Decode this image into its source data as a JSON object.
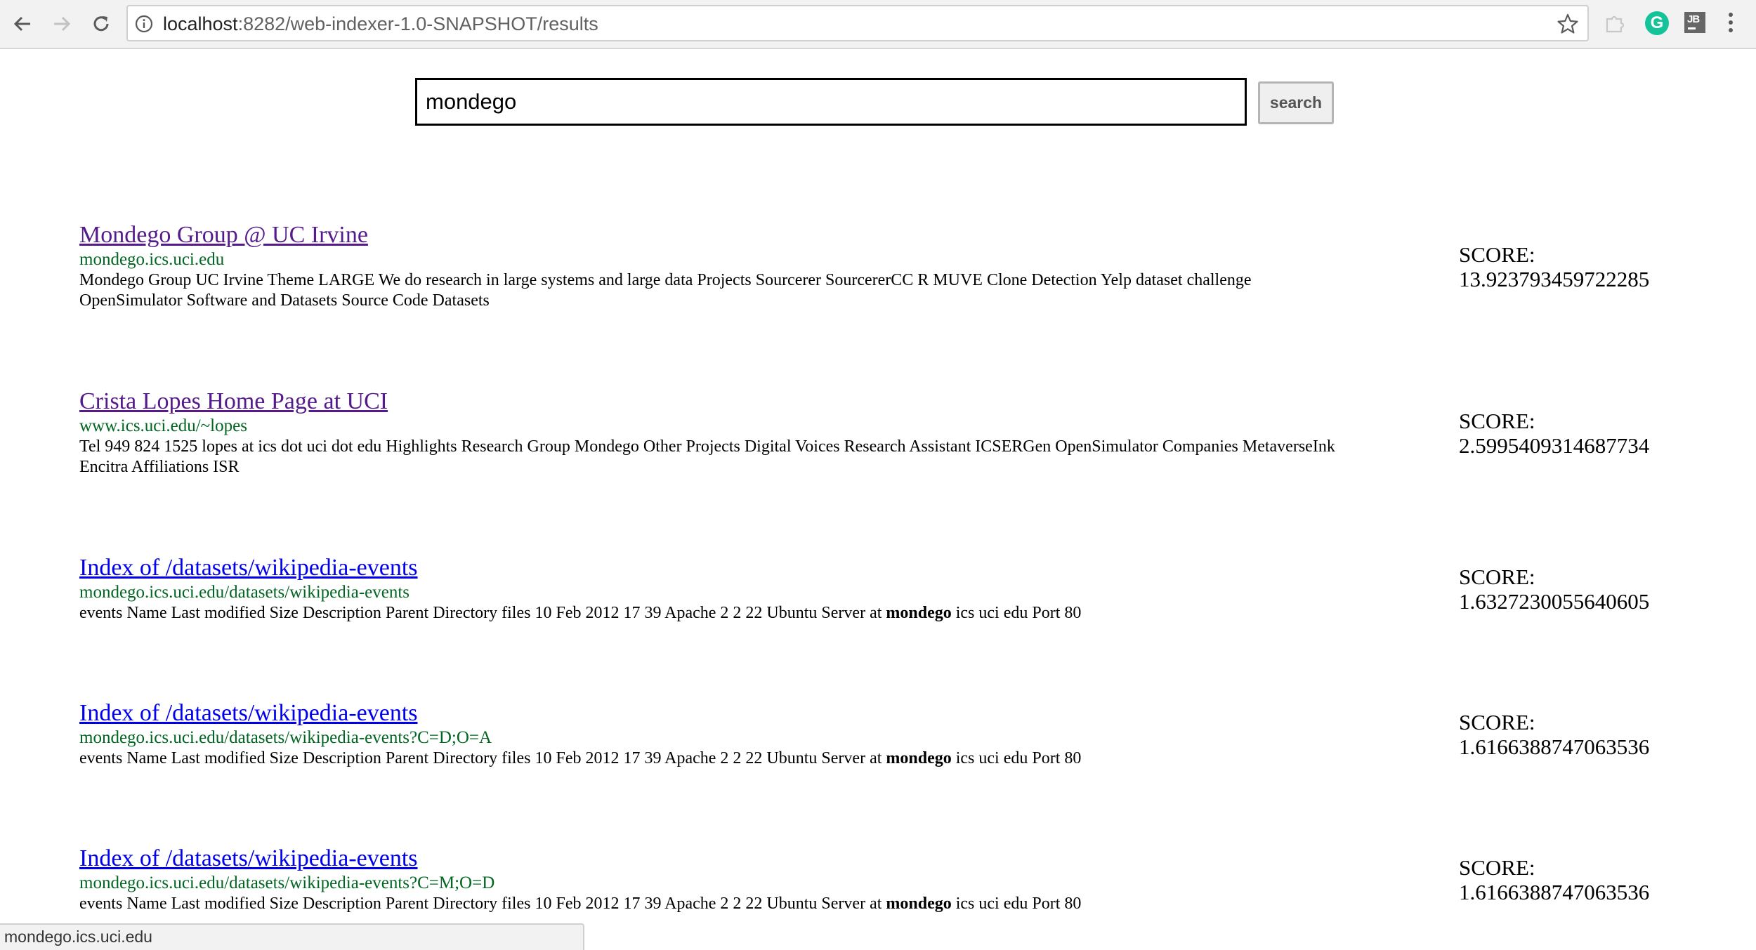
{
  "browser": {
    "url_host": "localhost",
    "url_rest": ":8282/web-indexer-1.0-SNAPSHOT/results",
    "extensions": [
      "grammarly-extension-icon",
      "jetbrains-extension-icon"
    ],
    "grammarly_letter": "G",
    "jetbrains_letters": "JB"
  },
  "search": {
    "query": "mondego",
    "button_label": "search"
  },
  "results": [
    {
      "title": "Mondego Group @ UC Irvine",
      "link": "mondego.ics.uci.edu",
      "snippet_before": "Mondego Group UC Irvine Theme LARGE We do research in large systems and large data Projects Sourcerer SourcererCC R MUVE Clone Detection Yelp dataset challenge OpenSimulator Software and Datasets Source Code Datasets",
      "snippet_bold": "",
      "snippet_after": "",
      "score_label": "SCORE:",
      "score": "13.923793459722285",
      "visited": true
    },
    {
      "title": "Crista Lopes Home Page at UCI",
      "link": "www.ics.uci.edu/~lopes",
      "snippet_before": "Tel 949 824 1525 lopes at ics dot uci dot edu Highlights Research Group Mondego Other Projects Digital Voices Research Assistant ICSERGen OpenSimulator Companies MetaverseInk Encitra Affiliations ISR",
      "snippet_bold": "",
      "snippet_after": "",
      "score_label": "SCORE:",
      "score": "2.5995409314687734",
      "visited": true
    },
    {
      "title": "Index of /datasets/wikipedia-events",
      "link": "mondego.ics.uci.edu/datasets/wikipedia-events",
      "snippet_before": "events Name Last modified Size Description Parent Directory files 10 Feb 2012 17 39 Apache 2 2 22 Ubuntu Server at ",
      "snippet_bold": "mondego",
      "snippet_after": " ics uci edu Port 80",
      "score_label": "SCORE:",
      "score": "1.6327230055640605",
      "visited": false
    },
    {
      "title": "Index of /datasets/wikipedia-events",
      "link": "mondego.ics.uci.edu/datasets/wikipedia-events?C=D;O=A",
      "snippet_before": "events Name Last modified Size Description Parent Directory files 10 Feb 2012 17 39 Apache 2 2 22 Ubuntu Server at ",
      "snippet_bold": "mondego",
      "snippet_after": " ics uci edu Port 80",
      "score_label": "SCORE:",
      "score": "1.6166388747063536",
      "visited": false
    },
    {
      "title": "Index of /datasets/wikipedia-events",
      "link": "mondego.ics.uci.edu/datasets/wikipedia-events?C=M;O=D",
      "snippet_before": "events Name Last modified Size Description Parent Directory files 10 Feb 2012 17 39 Apache 2 2 22 Ubuntu Server at ",
      "snippet_bold": "mondego",
      "snippet_after": " ics uci edu Port 80",
      "score_label": "SCORE:",
      "score": "1.6166388747063536",
      "visited": false
    }
  ],
  "status_bar": {
    "text": "mondego.ics.uci.edu"
  }
}
